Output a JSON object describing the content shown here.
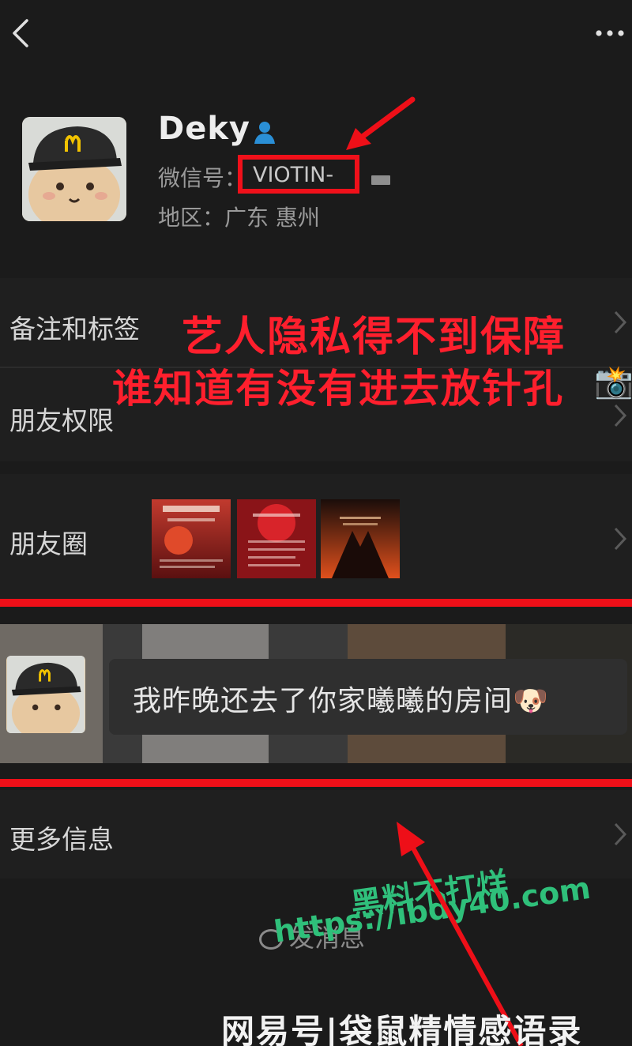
{
  "topbar": {
    "back_icon": "chevron-left-icon",
    "more_icon": "more-dots-icon"
  },
  "profile": {
    "nickname": "Deky",
    "verified_icon": "friend-person-icon",
    "wechat_id_label": "微信号：",
    "wechat_id": "VIOTIN-",
    "region": "地区：广东 惠州"
  },
  "rows": {
    "remarks": "备注和标签",
    "permission": "朋友权限",
    "moments": "朋友圈",
    "more_info": "更多信息"
  },
  "overlay": {
    "line1": "艺人隐私得不到保障",
    "line2": "谁知道有没有进去放针孔",
    "emoji": "📸"
  },
  "chat": {
    "message": "我昨晚还去了你家曦曦的房间",
    "emoji": "🐶"
  },
  "bottom": {
    "send_message": "发消息",
    "watermark_line1": "黑料不打烊",
    "watermark_line2": "https://ibdy40.com",
    "caption": "网易号|袋鼠精情感语录"
  },
  "colors": {
    "accent_red": "#ee0f18",
    "watermark_green": "#30c07c",
    "background": "#1b1b1b"
  }
}
